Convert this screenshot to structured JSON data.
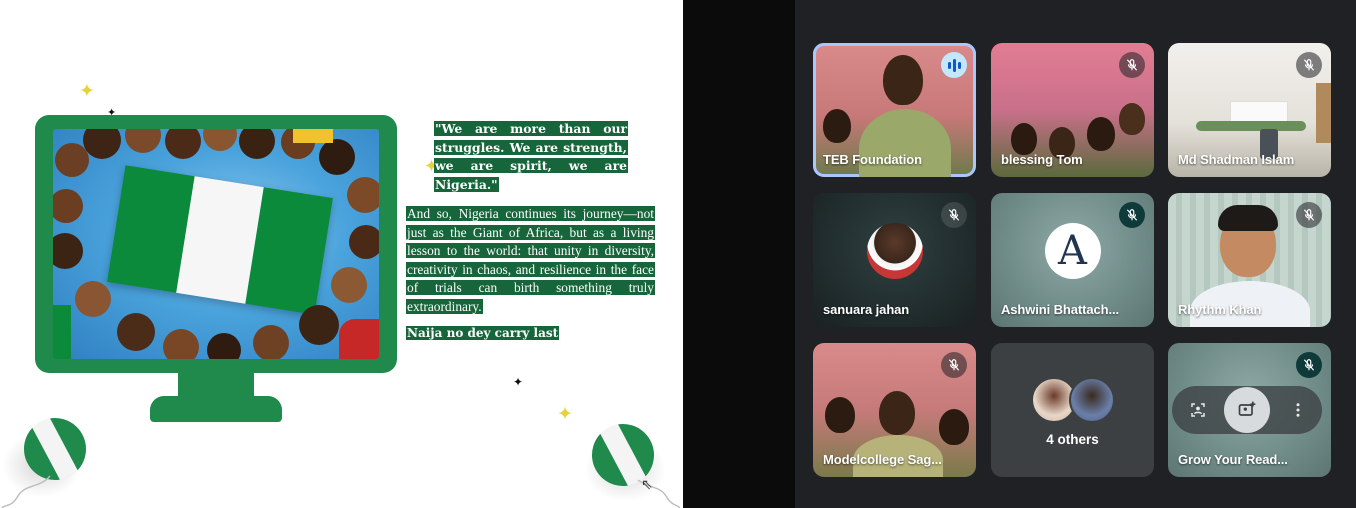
{
  "slide": {
    "quote": "\"We are more than our struggles. We are strength, we are spirit, we are Nigeria.\"",
    "paragraph": "And so, Nigeria continues its journey—not just as the Giant of Africa, but as a living lesson to the world: that unity in diversity, creativity in chaos, and resilience in the face of trials can birth something truly extraordinary.",
    "closing": "Naija no dey carry last",
    "colors": {
      "green": "#1f8a4c",
      "highlight": "#17653a",
      "sparkle_yellow": "#e6d23a"
    }
  },
  "meet": {
    "participants": [
      {
        "name": "TEB Foundation",
        "status": "speaking-icon"
      },
      {
        "name": "blessing Tom",
        "status": "mic-off-icon"
      },
      {
        "name": "Md Shadman Islam",
        "status": "mic-off-icon"
      },
      {
        "name": "sanuara jahan",
        "status": "mic-off-icon"
      },
      {
        "name": "Ashwini Bhattach...",
        "status": "mic-off-icon"
      },
      {
        "name": "Rhythm Khan",
        "status": "mic-off-icon"
      },
      {
        "name": "Modelcollege Sag...",
        "status": "mic-off-icon"
      },
      {
        "name": "Grow Your Read...",
        "status": "mic-off-icon"
      }
    ],
    "others_label": "4 others",
    "avatar_letter": "A",
    "colors": {
      "active_border": "#a8c7fa",
      "speaking_bg": "#c2e7ff"
    }
  }
}
